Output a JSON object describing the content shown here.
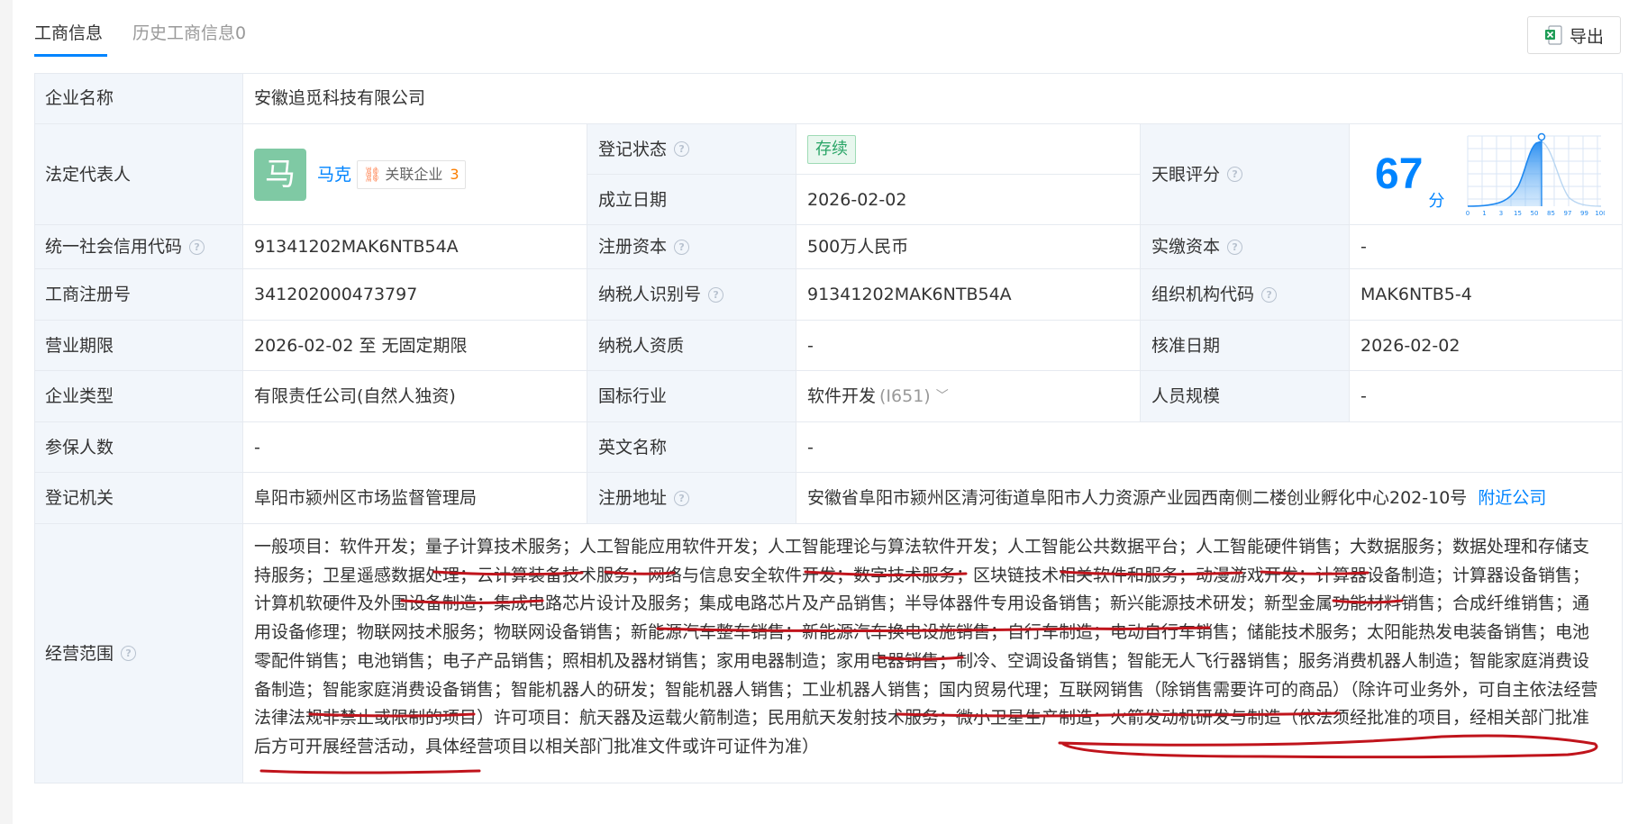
{
  "tabs": {
    "active": "工商信息",
    "history": "历史工商信息0"
  },
  "export_label": "导出",
  "labels": {
    "company_name": "企业名称",
    "legal_rep": "法定代表人",
    "reg_status": "登记状态",
    "founded": "成立日期",
    "tianyan_score": "天眼评分",
    "credit_code": "统一社会信用代码",
    "reg_capital": "注册资本",
    "paid_capital": "实缴资本",
    "reg_number": "工商注册号",
    "taxpayer_id": "纳税人识别号",
    "org_code": "组织机构代码",
    "term": "营业期限",
    "taxpayer_qual": "纳税人资质",
    "approval_date": "核准日期",
    "company_type": "企业类型",
    "industry": "国标行业",
    "staff_size": "人员规模",
    "insured": "参保人数",
    "english_name": "英文名称",
    "authority": "登记机关",
    "address": "注册地址",
    "scope": "经营范围"
  },
  "values": {
    "company_name": "安徽追觅科技有限公司",
    "legal_rep_avatar": "马",
    "legal_rep_name": "马克",
    "assoc_label": "关联企业",
    "assoc_count": "3",
    "reg_status": "存续",
    "founded": "2026-02-02",
    "score": "67",
    "score_unit": "分",
    "credit_code": "91341202MAK6NTB54A",
    "reg_capital": "500万人民币",
    "paid_capital": "-",
    "reg_number": "341202000473797",
    "taxpayer_id": "91341202MAK6NTB54A",
    "org_code": "MAK6NTB5-4",
    "term": "2026-02-02 至 无固定期限",
    "taxpayer_qual": "-",
    "approval_date": "2026-02-02",
    "company_type": "有限责任公司(自然人独资)",
    "industry": "软件开发",
    "industry_code": "(I651)",
    "staff_size": "-",
    "insured": "-",
    "english_name": "-",
    "authority": "阜阳市颍州区市场监督管理局",
    "address": "安徽省阜阳市颍州区清河街道阜阳市人力资源产业园西南侧二楼创业孵化中心202-10号",
    "nearby_link": "附近公司",
    "scope": "一般项目：软件开发；量子计算技术服务；人工智能应用软件开发；人工智能理论与算法软件开发；人工智能公共数据平台；人工智能硬件销售；大数据服务；数据处理和存储支持服务；卫星遥感数据处理；云计算装备技术服务；网络与信息安全软件开发；数字技术服务；区块链技术相关软件和服务；动漫游戏开发；计算器设备制造；计算器设备销售；计算机软硬件及外围设备制造；集成电路芯片设计及服务；集成电路芯片及产品销售；半导体器件专用设备销售；新兴能源技术研发；新型金属功能材料销售；合成纤维销售；通用设备修理；物联网技术服务；物联网设备销售；新能源汽车整车销售；新能源汽车换电设施销售；自行车制造；电动自行车销售；储能技术服务；太阳能热发电装备销售；电池零配件销售；电池销售；电子产品销售；照相机及器材销售；家用电器制造；家用电器销售；制冷、空调设备销售；智能无人飞行器销售；服务消费机器人制造；智能家庭消费设备制造；智能家庭消费设备销售；智能机器人的研发；智能机器人销售；工业机器人销售；国内贸易代理；互联网销售（除销售需要许可的商品）（除许可业务外，可自主依法经营法律法规非禁止或限制的项目）许可项目：航天器及运载火箭制造；民用航天发射技术服务；微小卫星生产制造；火箭发动机研发与制造（依法须经批准的项目，经相关部门批准后方可开展经营活动，具体经营项目以相关部门批准文件或许可证件为准）"
  },
  "score_chart": {
    "ticks": [
      "0",
      "1",
      "3",
      "15",
      "50",
      "85",
      "97",
      "99",
      "100"
    ]
  },
  "colors": {
    "accent": "#0084ff",
    "label_bg": "#f2f6fb",
    "status_green": "#2aa567",
    "annotation_red": "#c0141c"
  }
}
